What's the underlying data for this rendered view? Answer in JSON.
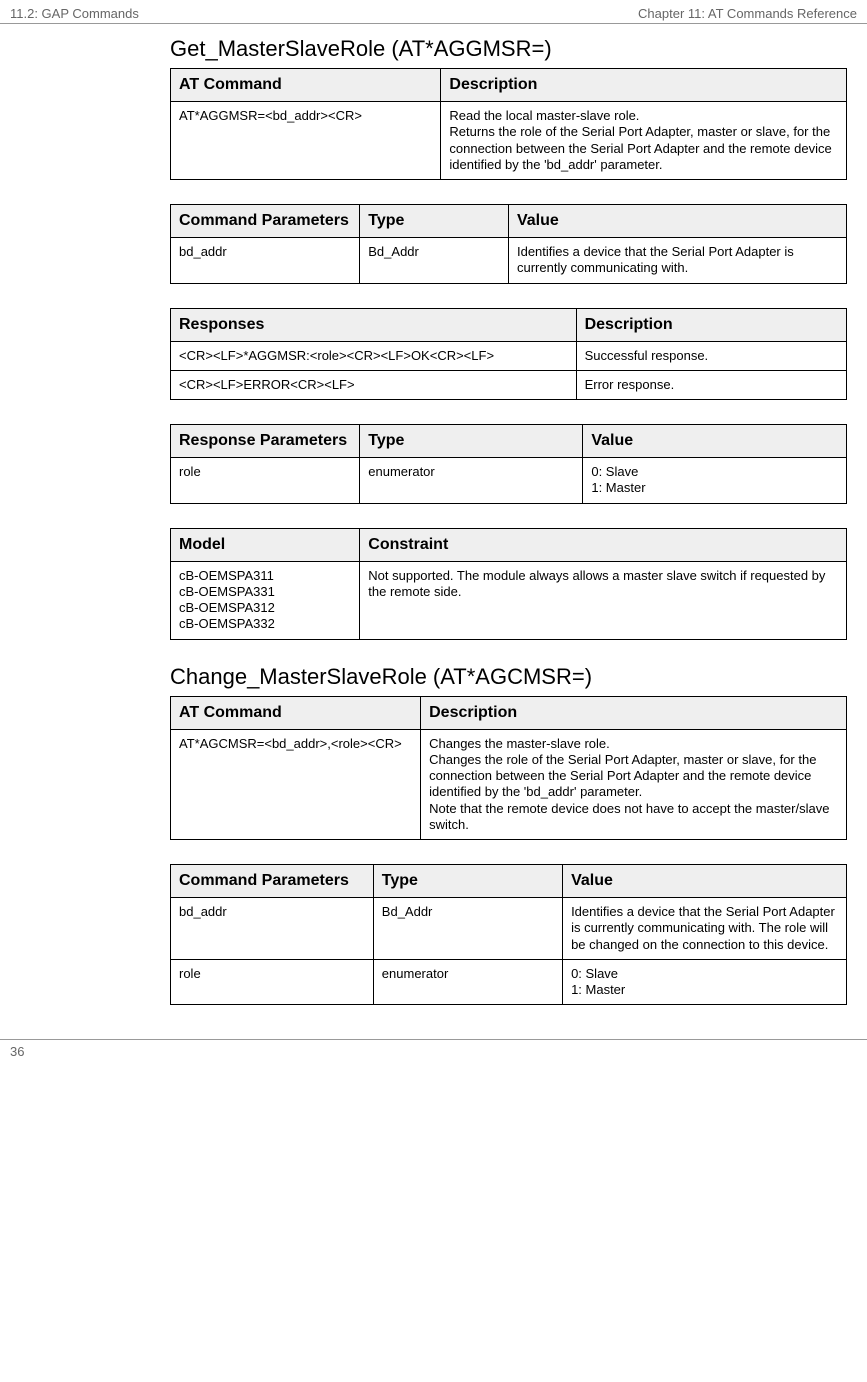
{
  "header": {
    "left": "11.2: GAP Commands",
    "right": "Chapter 11: AT Commands Reference"
  },
  "sections": [
    {
      "title": "Get_MasterSlaveRole (AT*AGGMSR=)",
      "tables": [
        {
          "headers": [
            "AT Command",
            "Description"
          ],
          "widths": [
            "40%",
            "60%"
          ],
          "rows": [
            [
              "AT*AGGMSR=<bd_addr><CR>",
              "Read the local master-slave role.\nReturns the role of the Serial Port Adapter, master or slave, for the connection between the Serial Port Adapter and the remote device identified by the 'bd_addr' parameter."
            ]
          ]
        },
        {
          "headers": [
            "Command Parameters",
            "Type",
            "Value"
          ],
          "widths": [
            "28%",
            "22%",
            "50%"
          ],
          "rows": [
            [
              "bd_addr",
              "Bd_Addr",
              "Identifies a device that the Serial Port Adapter is currently communicating with."
            ]
          ]
        },
        {
          "headers": [
            "Responses",
            "Description"
          ],
          "widths": [
            "60%",
            "40%"
          ],
          "rows": [
            [
              "<CR><LF>*AGGMSR:<role><CR><LF>OK<CR><LF>",
              "Successful response."
            ],
            [
              "<CR><LF>ERROR<CR><LF>",
              "Error response."
            ]
          ]
        },
        {
          "headers": [
            "Response Parameters",
            "Type",
            "Value"
          ],
          "widths": [
            "28%",
            "33%",
            "39%"
          ],
          "rows": [
            [
              "role",
              "enumerator",
              "0: Slave\n1: Master"
            ]
          ]
        },
        {
          "headers": [
            "Model",
            "Constraint"
          ],
          "widths": [
            "28%",
            "72%"
          ],
          "rows": [
            [
              "cB-OEMSPA311\ncB-OEMSPA331\ncB-OEMSPA312\ncB-OEMSPA332",
              "Not supported. The module always allows a master slave switch if requested by the remote side."
            ]
          ]
        }
      ]
    },
    {
      "title": "Change_MasterSlaveRole (AT*AGCMSR=)",
      "tables": [
        {
          "headers": [
            "AT Command",
            "Description"
          ],
          "widths": [
            "37%",
            "63%"
          ],
          "rows": [
            [
              "AT*AGCMSR=<bd_addr>,<role><CR>",
              "Changes the master-slave role.\nChanges the role of the Serial Port Adapter, master or slave, for the connection between the Serial Port Adapter and the remote device identified by the 'bd_addr' parameter.\nNote that the remote device does not have to accept the master/slave switch."
            ]
          ]
        },
        {
          "headers": [
            "Command Parameters",
            "Type",
            "Value"
          ],
          "widths": [
            "30%",
            "28%",
            "42%"
          ],
          "rows": [
            [
              "bd_addr",
              "Bd_Addr",
              "Identifies a device that the Serial Port Adapter is currently communicating with. The role will be changed on the connection to this device."
            ],
            [
              "role",
              "enumerator",
              "0: Slave\n1: Master"
            ]
          ]
        }
      ]
    }
  ],
  "footer": {
    "page": "36"
  }
}
